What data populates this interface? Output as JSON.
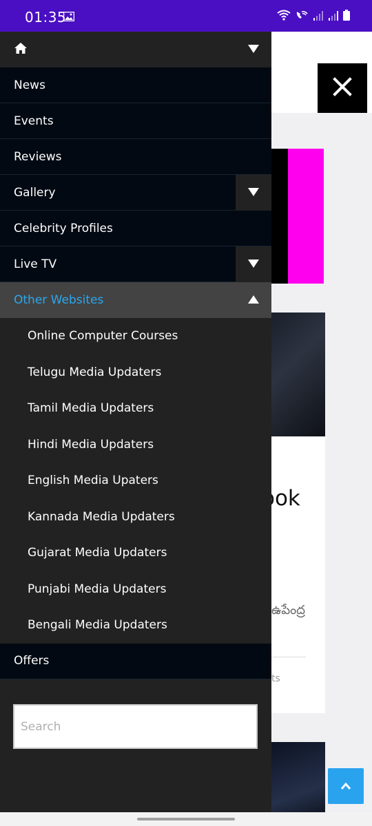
{
  "status_bar": {
    "time": "01:35",
    "icons": [
      "gallery-icon",
      "wifi-icon",
      "wifi-calling-icon",
      "signal-icon",
      "signal-icon",
      "battery-icon"
    ]
  },
  "drawer": {
    "home_icon": "home-icon",
    "items": [
      {
        "label": "News"
      },
      {
        "label": "Events"
      },
      {
        "label": "Reviews"
      },
      {
        "label": "Gallery"
      },
      {
        "label": "Celebrity Profiles"
      },
      {
        "label": "Live TV"
      },
      {
        "label": "Other Websites"
      },
      {
        "label": "Offers"
      }
    ],
    "sub_items": [
      {
        "label": "Online Computer Courses"
      },
      {
        "label": "Telugu Media Updaters"
      },
      {
        "label": "Tamil Media Updaters"
      },
      {
        "label": "Hindi Media Updaters"
      },
      {
        "label": "English Media Upaters"
      },
      {
        "label": "Kannada Media Updaters"
      },
      {
        "label": "Gujarat Media Updaters"
      },
      {
        "label": "Punjabi Media Updaters"
      },
      {
        "label": "Bengali Media Updaters"
      }
    ],
    "search": {
      "placeholder": "Search",
      "value": ""
    }
  },
  "background_page": {
    "card_title_fragment": "ook",
    "card_telugu_fragment": "ఉపేంద్ర",
    "card_meta_fragment": "ts"
  },
  "colors": {
    "status_bar": "#4a0fc2",
    "drawer_bg": "#222222",
    "menu_row_bg": "#020912",
    "active_row_bg": "#434343",
    "active_text": "#2ba8f0",
    "banner_pink": "#ff00ee",
    "scroll_top_button": "#2aa3ef"
  }
}
